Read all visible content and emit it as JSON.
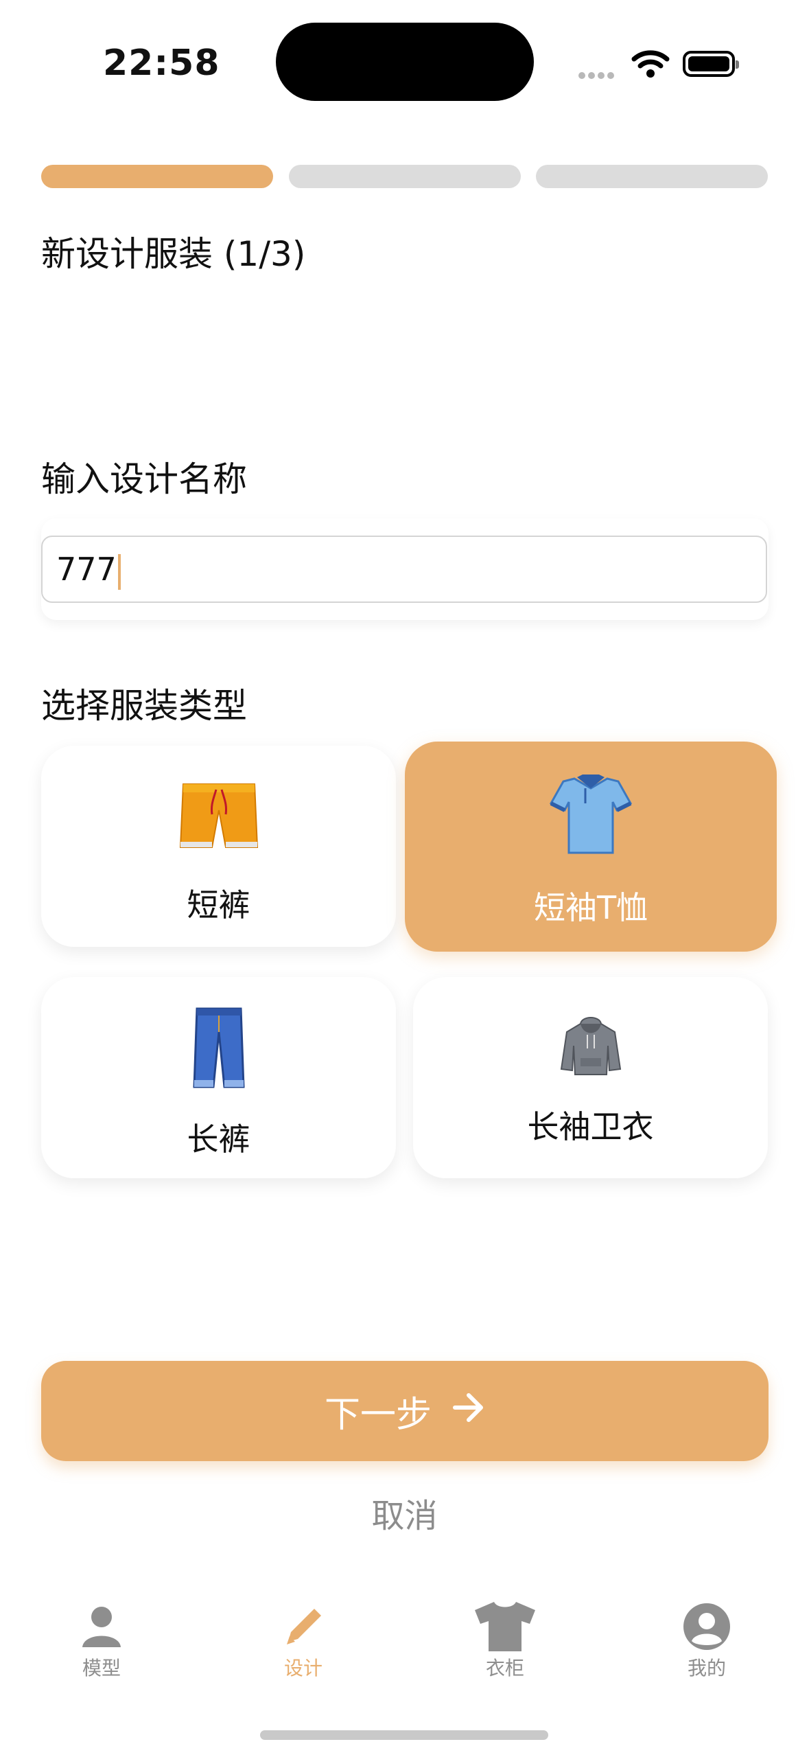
{
  "status_bar": {
    "time": "22:58"
  },
  "progress": {
    "current_step": 1,
    "total_steps": 3,
    "active_color": "#e8ae6e"
  },
  "header": {
    "title": "新设计服装 (1/3)"
  },
  "name_section": {
    "label": "输入设计名称",
    "input_value": "777",
    "placeholder": ""
  },
  "type_section": {
    "label": "选择服装类型",
    "options": [
      {
        "label": "短裤",
        "icon": "shorts-icon",
        "selected": false
      },
      {
        "label": "短袖T恤",
        "icon": "polo-shirt-icon",
        "selected": true
      },
      {
        "label": "长裤",
        "icon": "jeans-icon",
        "selected": false
      },
      {
        "label": "长袖卫衣",
        "icon": "hoodie-icon",
        "selected": false
      }
    ]
  },
  "actions": {
    "next_label": "下一步",
    "next_icon": "arrow-right-icon",
    "cancel_label": "取消"
  },
  "tab_bar": {
    "active_color": "#e8ae6e",
    "items": [
      {
        "label": "模型",
        "icon": "person-icon",
        "active": false
      },
      {
        "label": "设计",
        "icon": "pencil-icon",
        "active": true
      },
      {
        "label": "衣柜",
        "icon": "tshirt-icon",
        "active": false
      },
      {
        "label": "我的",
        "icon": "profile-circle-icon",
        "active": false
      }
    ]
  }
}
